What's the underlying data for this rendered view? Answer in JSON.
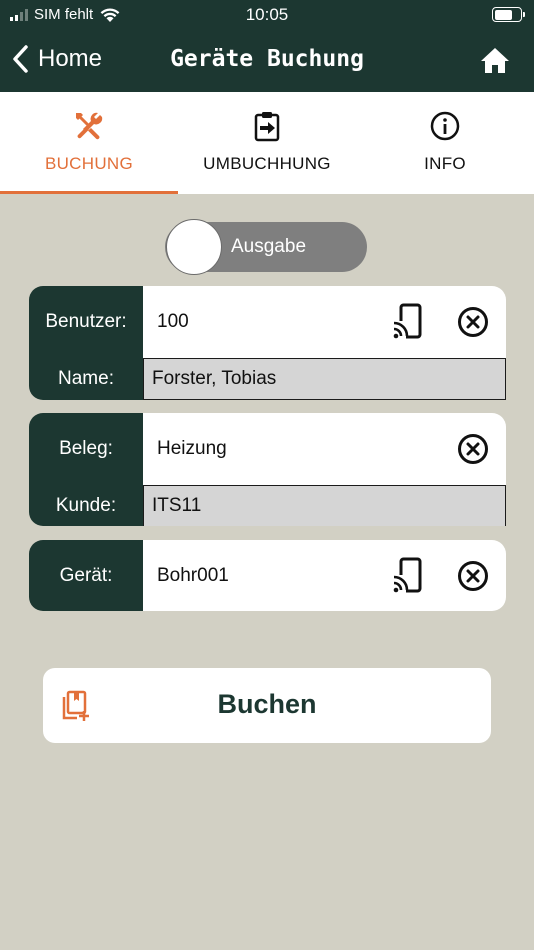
{
  "status": {
    "carrier": "SIM fehlt",
    "time": "10:05",
    "battery_level": 0.7
  },
  "nav": {
    "back_label": "Home",
    "title": "Geräte Buchung"
  },
  "tabs": [
    {
      "label": "BUCHUNG",
      "icon": "tools-icon",
      "active": true
    },
    {
      "label": "UMBUCHHUNG",
      "icon": "clipboard-arrow-icon",
      "active": false
    },
    {
      "label": "INFO",
      "icon": "info-icon",
      "active": false
    }
  ],
  "toggle": {
    "label": "Ausgabe",
    "on": false
  },
  "form": {
    "benutzer": {
      "label": "Benutzer:",
      "value": "100"
    },
    "name": {
      "label": "Name:",
      "value": "Forster, Tobias"
    },
    "beleg": {
      "label": "Beleg:",
      "value": "Heizung"
    },
    "kunde": {
      "label": "Kunde:",
      "value": "ITS11"
    },
    "geraet": {
      "label": "Gerät:",
      "value": "Bohr001"
    }
  },
  "buchen": {
    "label": "Buchen"
  },
  "colors": {
    "primary": "#1c3731",
    "accent": "#e2703a",
    "background": "#d2d0c4"
  }
}
